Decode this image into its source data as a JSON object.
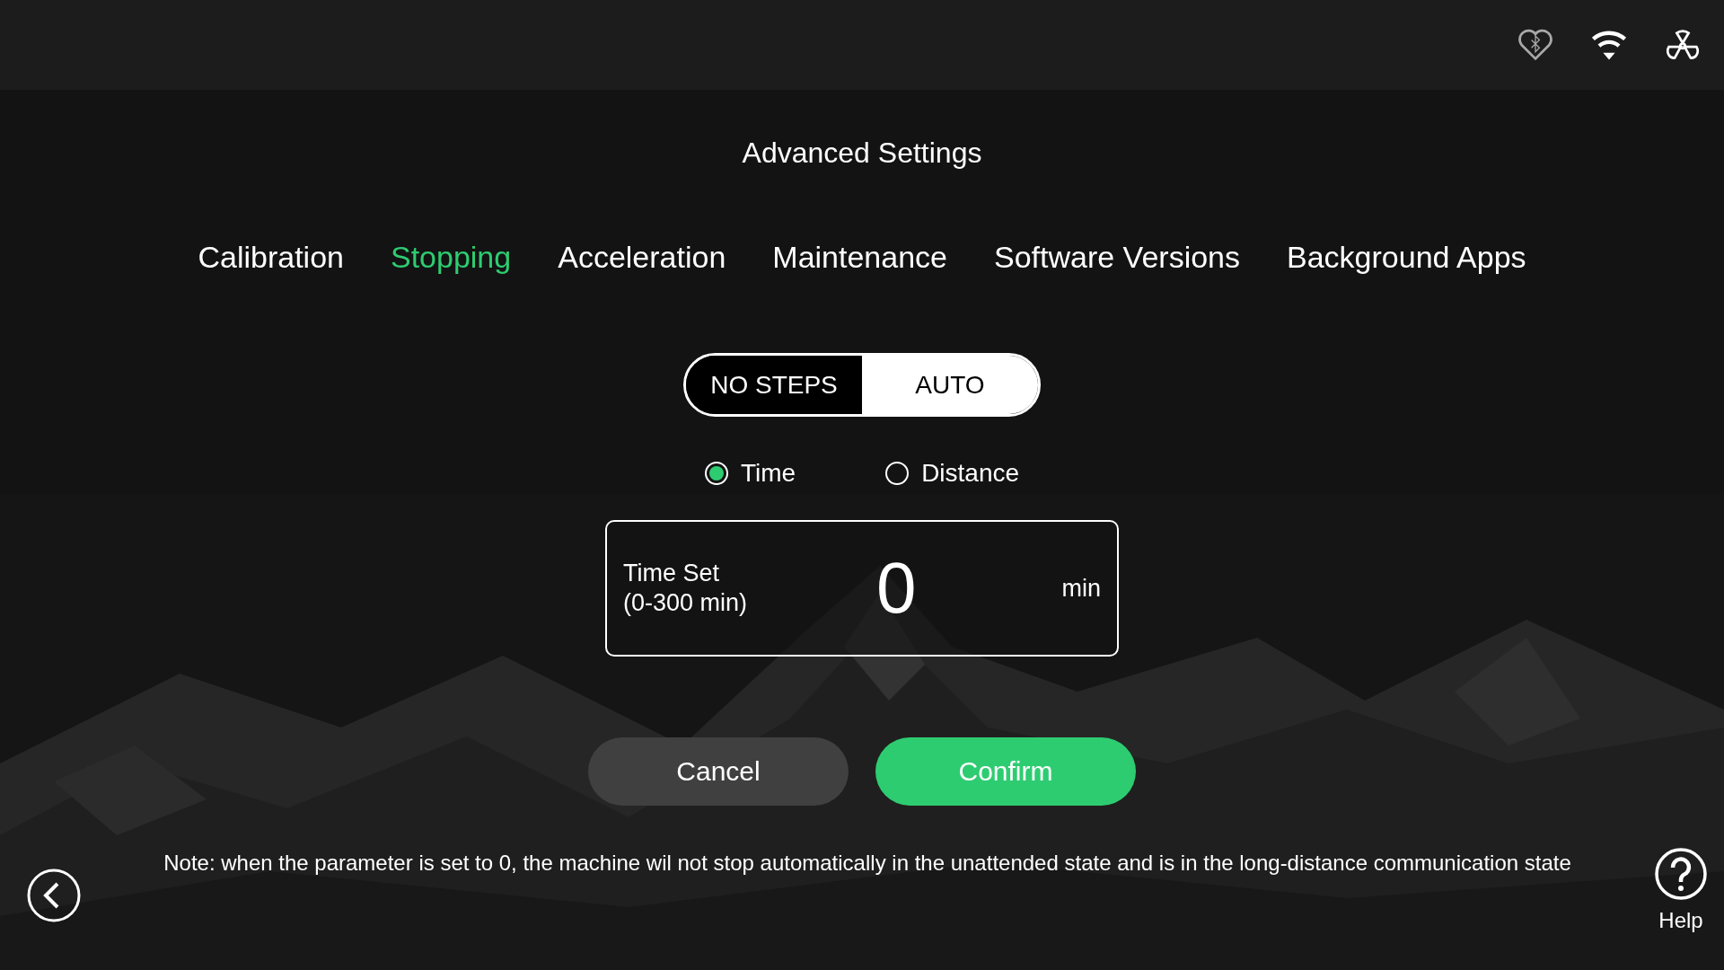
{
  "title": "Advanced Settings",
  "tabs": [
    {
      "label": "Calibration",
      "selected": false
    },
    {
      "label": "Stopping",
      "selected": true
    },
    {
      "label": "Acceleration",
      "selected": false
    },
    {
      "label": "Maintenance",
      "selected": false
    },
    {
      "label": "Software Versions",
      "selected": false
    },
    {
      "label": "Background Apps",
      "selected": false
    }
  ],
  "mode_toggle": [
    {
      "label": "NO STEPS",
      "selected": false
    },
    {
      "label": "AUTO",
      "selected": true
    }
  ],
  "radios": [
    {
      "label": "Time",
      "selected": true
    },
    {
      "label": "Distance",
      "selected": false
    }
  ],
  "time_field": {
    "label_line_1": "Time Set",
    "label_line_2": "(0-300 min)",
    "value": "0",
    "unit": "min"
  },
  "buttons": [
    {
      "label": "Cancel",
      "kind": "secondary"
    },
    {
      "label": "Confirm",
      "kind": "primary"
    }
  ],
  "note": "Note: when the parameter is set to 0, the machine wil not stop automatically in the unattended state and is in the long-distance communication state",
  "help": {
    "label": "Help"
  }
}
